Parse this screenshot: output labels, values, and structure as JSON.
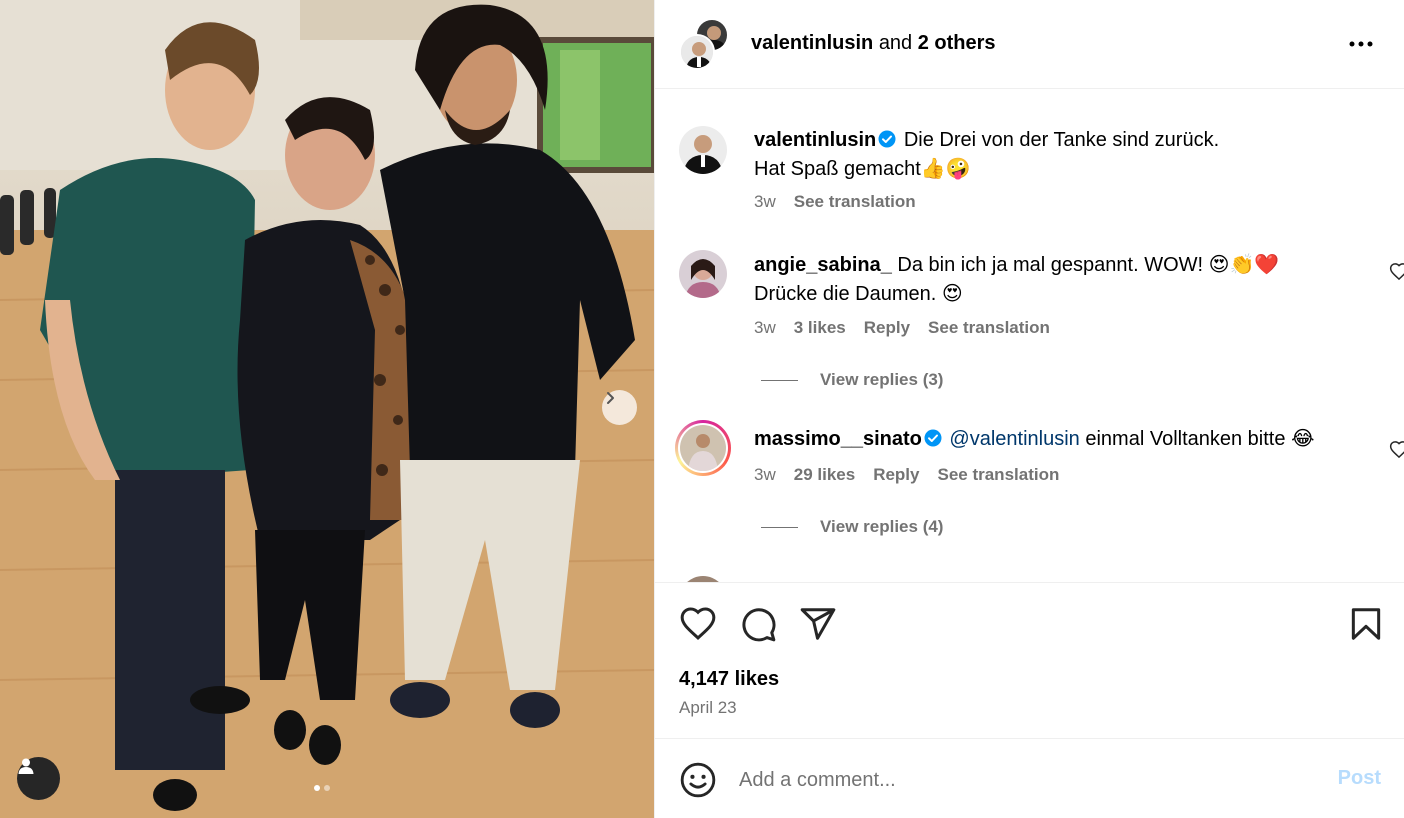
{
  "header": {
    "username": "valentinlusin",
    "and_text": "and",
    "others": "2 others"
  },
  "caption": {
    "username": "valentinlusin",
    "line1": "Die Drei von der Tanke sind zurück.",
    "line2": "Hat Spaß gemacht",
    "line2_emoji": "👍🤪",
    "time": "3w",
    "see_translation": "See translation"
  },
  "comments": [
    {
      "username": "angie_sabina_",
      "text": "Da bin ich ja mal gespannt. WOW!",
      "emoji": "😍👏❤️",
      "line2": "Drücke die Daumen.",
      "line2_emoji": "😍",
      "time": "3w",
      "likes": "3 likes",
      "reply": "Reply",
      "see_translation": "See translation",
      "view_replies": "View replies (3)"
    },
    {
      "username": "massimo__sinato",
      "mention": "@valentinlusin",
      "text": "einmal Volltanken bitte",
      "emoji": "😂",
      "time": "3w",
      "likes": "29 likes",
      "reply": "Reply",
      "see_translation": "See translation",
      "view_replies": "View replies (4)"
    }
  ],
  "post": {
    "likes": "4,147 likes",
    "date": "April 23"
  },
  "composer": {
    "placeholder": "Add a comment...",
    "post_label": "Post"
  },
  "icons": {
    "more": "more-options-icon",
    "next": "chevron-right-icon",
    "tag": "user-tag-icon",
    "like": "heart-icon",
    "comment": "comment-icon",
    "share": "paper-plane-icon",
    "save": "bookmark-icon",
    "emoji": "emoji-smiley-icon",
    "verified": "verified-badge-icon"
  },
  "colors": {
    "link": "#00376b",
    "verified": "#0095f6",
    "post_disabled": "#b7dcfd",
    "secondary_text": "#737373"
  },
  "carousel": {
    "current": 1,
    "total": 2
  }
}
